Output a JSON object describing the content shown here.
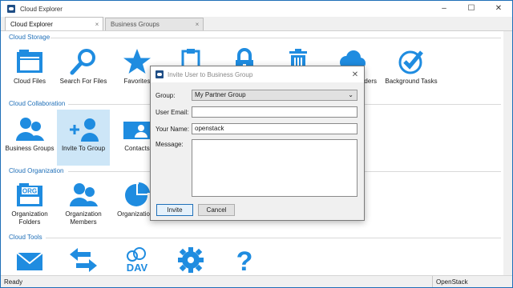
{
  "window": {
    "title": "Cloud Explorer",
    "controls": [
      "–",
      "☐",
      "✕"
    ]
  },
  "tabs": [
    {
      "label": "Cloud Explorer",
      "close": "×"
    },
    {
      "label": "Business Groups",
      "close": "×"
    }
  ],
  "sections": {
    "storage": "Cloud Storage",
    "collaboration": "Cloud Collaboration",
    "organization": "Cloud Organization",
    "tools": "Cloud Tools"
  },
  "storage_tiles": [
    "Cloud Files",
    "Search For Files",
    "Favorites",
    "",
    "",
    "",
    "viders",
    "Background Tasks"
  ],
  "collab_tiles": [
    "Business Groups",
    "Invite To Group",
    "Contacts"
  ],
  "org_tiles": [
    "Organization Folders",
    "Organization Members",
    "Organization I"
  ],
  "tools_tiles": [
    "DAV"
  ],
  "dialog": {
    "title": "Invite User to Business Group",
    "close": "✕",
    "group_label": "Group:",
    "group_value": "My Partner Group",
    "email_label": "User Email:",
    "email_value": "",
    "name_label": "Your Name:",
    "name_value": "openstack",
    "message_label": "Message:",
    "message_value": "",
    "invite_button": "Invite",
    "cancel_button": "Cancel"
  },
  "status": {
    "left": "Ready",
    "right": "OpenStack"
  },
  "colors": {
    "accent": "#1f8ce0",
    "selection": "#cde6f7",
    "section": "#1f6fb8"
  }
}
